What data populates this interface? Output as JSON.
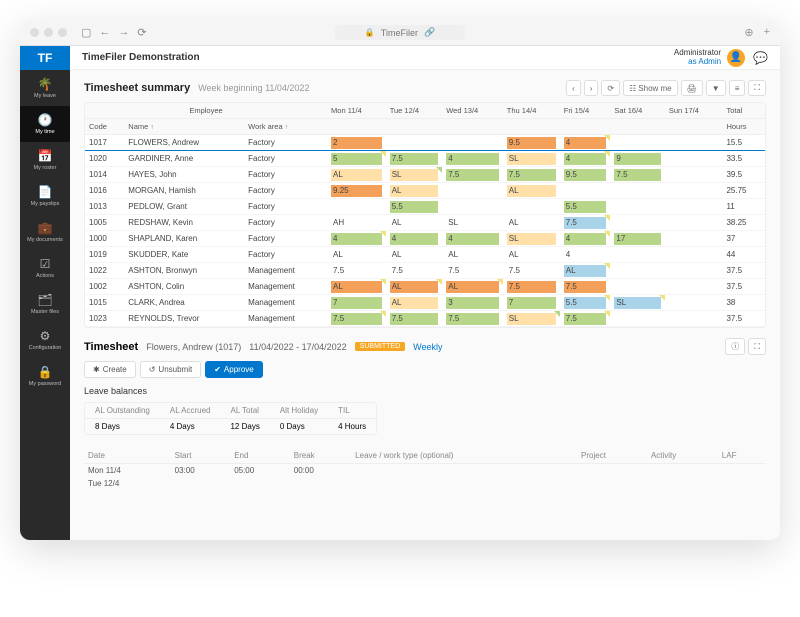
{
  "browser": {
    "url_label": "TimeFiler"
  },
  "app": {
    "title": "TimeFiler Demonstration",
    "user_name": "Administrator",
    "user_role": "as Admin",
    "logo": "TF"
  },
  "nav": [
    {
      "label": "My leave",
      "icon": "palm",
      "active": false
    },
    {
      "label": "My time",
      "icon": "clock",
      "active": true
    },
    {
      "label": "My roster",
      "icon": "calendar",
      "active": false
    },
    {
      "label": "My payslips",
      "icon": "list",
      "active": false
    },
    {
      "label": "My documents",
      "icon": "briefcase",
      "active": false
    },
    {
      "label": "Actions",
      "icon": "tasks",
      "active": false
    },
    {
      "label": "Master files",
      "icon": "files",
      "active": false
    },
    {
      "label": "Configuration",
      "icon": "gear",
      "active": false
    },
    {
      "label": "My password",
      "icon": "lock",
      "active": false
    }
  ],
  "summary": {
    "title": "Timesheet summary",
    "subtitle": "Week beginning 11/04/2022",
    "showme": "Show me",
    "group_header": "Employee",
    "headers": {
      "code": "Code",
      "name": "Name",
      "workarea": "Work area",
      "total": "Total",
      "hours": "Hours"
    },
    "days": [
      "Mon 11/4",
      "Tue 12/4",
      "Wed 13/4",
      "Thu 14/4",
      "Fri 15/4",
      "Sat 16/4",
      "Sun 17/4"
    ],
    "rows": [
      {
        "code": "1017",
        "name": "FLOWERS, Andrew",
        "area": "Factory",
        "cells": [
          {
            "v": "2",
            "c": "c-orange"
          },
          {
            "v": ""
          },
          {
            "v": ""
          },
          {
            "v": "9.5",
            "c": "c-orange"
          },
          {
            "v": "4",
            "c": "c-orange",
            "corner": "#f3e27b"
          },
          {
            "v": ""
          },
          {
            "v": ""
          }
        ],
        "total": "15.5",
        "selected": true
      },
      {
        "code": "1020",
        "name": "GARDINER, Anne",
        "area": "Factory",
        "cells": [
          {
            "v": "5",
            "c": "c-green",
            "corner": "#f3e27b"
          },
          {
            "v": "7.5",
            "c": "c-green"
          },
          {
            "v": "4",
            "c": "c-green"
          },
          {
            "v": "SL",
            "c": "c-tan"
          },
          {
            "v": "4",
            "c": "c-green",
            "corner": "#f3e27b"
          },
          {
            "v": "9",
            "c": "c-green"
          },
          {
            "v": ""
          }
        ],
        "total": "33.5"
      },
      {
        "code": "1014",
        "name": "HAYES, John",
        "area": "Factory",
        "cells": [
          {
            "v": "AL",
            "c": "c-tan"
          },
          {
            "v": "SL",
            "c": "c-tan",
            "corner": "#b8d68a"
          },
          {
            "v": "7.5",
            "c": "c-green"
          },
          {
            "v": "7.5",
            "c": "c-green"
          },
          {
            "v": "9.5",
            "c": "c-green"
          },
          {
            "v": "7.5",
            "c": "c-green"
          },
          {
            "v": ""
          }
        ],
        "total": "39.5"
      },
      {
        "code": "1016",
        "name": "MORGAN, Hamish",
        "area": "Factory",
        "cells": [
          {
            "v": "9.25",
            "c": "c-orange"
          },
          {
            "v": "AL",
            "c": "c-tan"
          },
          {
            "v": ""
          },
          {
            "v": "AL",
            "c": "c-tan"
          },
          {
            "v": ""
          },
          {
            "v": ""
          },
          {
            "v": ""
          }
        ],
        "total": "25.75"
      },
      {
        "code": "1013",
        "name": "PEDLOW, Grant",
        "area": "Factory",
        "cells": [
          {
            "v": ""
          },
          {
            "v": "5.5",
            "c": "c-green"
          },
          {
            "v": ""
          },
          {
            "v": ""
          },
          {
            "v": "5.5",
            "c": "c-green"
          },
          {
            "v": ""
          },
          {
            "v": ""
          }
        ],
        "total": "11"
      },
      {
        "code": "1005",
        "name": "REDSHAW, Kevin",
        "area": "Factory",
        "cells": [
          {
            "v": "AH",
            "c": "c-white"
          },
          {
            "v": "AL",
            "c": "c-white"
          },
          {
            "v": "SL",
            "c": "c-white"
          },
          {
            "v": "AL",
            "c": "c-white"
          },
          {
            "v": "7.5",
            "c": "c-blue",
            "corner": "#f3e27b"
          },
          {
            "v": ""
          },
          {
            "v": ""
          }
        ],
        "total": "38.25"
      },
      {
        "code": "1000",
        "name": "SHAPLAND, Karen",
        "area": "Factory",
        "cells": [
          {
            "v": "4",
            "c": "c-green",
            "corner": "#f3e27b"
          },
          {
            "v": "4",
            "c": "c-green"
          },
          {
            "v": "4",
            "c": "c-green"
          },
          {
            "v": "SL",
            "c": "c-tan"
          },
          {
            "v": "4",
            "c": "c-green",
            "corner": "#f3e27b"
          },
          {
            "v": "17",
            "c": "c-green"
          },
          {
            "v": ""
          }
        ],
        "total": "37"
      },
      {
        "code": "1019",
        "name": "SKUDDER, Kate",
        "area": "Factory",
        "cells": [
          {
            "v": "AL",
            "c": "c-white"
          },
          {
            "v": "AL",
            "c": "c-white"
          },
          {
            "v": "AL",
            "c": "c-white"
          },
          {
            "v": "AL",
            "c": "c-white"
          },
          {
            "v": "4",
            "c": "c-white"
          },
          {
            "v": ""
          },
          {
            "v": ""
          }
        ],
        "total": "44"
      },
      {
        "code": "1022",
        "name": "ASHTON, Bronwyn",
        "area": "Management",
        "cells": [
          {
            "v": "7.5",
            "c": "c-white"
          },
          {
            "v": "7.5",
            "c": "c-white"
          },
          {
            "v": "7.5",
            "c": "c-white"
          },
          {
            "v": "7.5",
            "c": "c-white"
          },
          {
            "v": "AL",
            "c": "c-blue",
            "corner": "#f3e27b"
          },
          {
            "v": ""
          },
          {
            "v": ""
          }
        ],
        "total": "37.5"
      },
      {
        "code": "1002",
        "name": "ASHTON, Colin",
        "area": "Management",
        "cells": [
          {
            "v": "AL",
            "c": "c-orange",
            "corner": "#f3e27b"
          },
          {
            "v": "AL",
            "c": "c-orange",
            "corner": "#f3e27b"
          },
          {
            "v": "AL",
            "c": "c-orange",
            "corner": "#f3e27b"
          },
          {
            "v": "7.5",
            "c": "c-orange"
          },
          {
            "v": "7.5",
            "c": "c-orange"
          },
          {
            "v": ""
          },
          {
            "v": ""
          }
        ],
        "total": "37.5"
      },
      {
        "code": "1015",
        "name": "CLARK, Andrea",
        "area": "Management",
        "cells": [
          {
            "v": "7",
            "c": "c-green"
          },
          {
            "v": "AL",
            "c": "c-tan"
          },
          {
            "v": "3",
            "c": "c-green"
          },
          {
            "v": "7",
            "c": "c-green"
          },
          {
            "v": "5.5",
            "c": "c-blue",
            "corner": "#f3e27b"
          },
          {
            "v": "SL",
            "c": "c-blue",
            "corner": "#f3e27b"
          },
          {
            "v": ""
          }
        ],
        "total": "38"
      },
      {
        "code": "1023",
        "name": "REYNOLDS, Trevor",
        "area": "Management",
        "cells": [
          {
            "v": "7.5",
            "c": "c-green",
            "corner": "#f3e27b"
          },
          {
            "v": "7.5",
            "c": "c-green"
          },
          {
            "v": "7.5",
            "c": "c-green"
          },
          {
            "v": "SL",
            "c": "c-tan",
            "corner": "#b8d68a"
          },
          {
            "v": "7.5",
            "c": "c-green",
            "corner": "#f3e27b"
          },
          {
            "v": ""
          },
          {
            "v": ""
          }
        ],
        "total": "37.5"
      }
    ]
  },
  "detail": {
    "title": "Timesheet",
    "employee": "Flowers, Andrew (1017)",
    "range": "11/04/2022 - 17/04/2022",
    "status": "Submitted",
    "mode": "Weekly",
    "actions": {
      "create": "Create",
      "unsubmit": "Unsubmit",
      "approve": "Approve"
    },
    "balances_title": "Leave balances",
    "balances": {
      "headers": [
        "AL Outstanding",
        "AL Accrued",
        "AL Total",
        "Alt Holiday",
        "TIL"
      ],
      "values": [
        "8 Days",
        "4 Days",
        "12 Days",
        "0 Days",
        "4 Hours"
      ]
    },
    "entry_headers": [
      "Date",
      "Start",
      "End",
      "Break",
      "Leave / work type (optional)",
      "Project",
      "Activity",
      "LAF"
    ],
    "entries": [
      {
        "date": "Mon 11/4",
        "start": "03:00",
        "end": "05:00",
        "break": "00:00"
      },
      {
        "date": "Tue 12/4",
        "start": "",
        "end": "",
        "break": ""
      }
    ]
  }
}
